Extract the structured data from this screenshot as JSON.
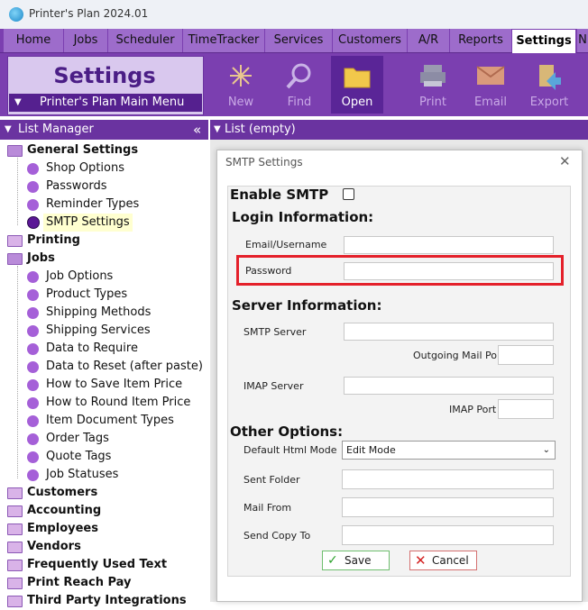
{
  "window": {
    "title": "Printer's Plan 2024.01"
  },
  "menu": {
    "tabs": [
      "Home",
      "Jobs",
      "Scheduler",
      "TimeTracker",
      "Services",
      "Customers",
      "A/R",
      "Reports",
      "Settings",
      "N"
    ],
    "active": "Settings"
  },
  "ribbon": {
    "title": "Settings",
    "main_menu": "Printer's Plan Main Menu",
    "buttons": {
      "new": "New",
      "find": "Find",
      "open": "Open",
      "print": "Print",
      "email": "Email",
      "export": "Export"
    }
  },
  "list_manager": {
    "header": "List Manager",
    "collapse_icon": "«",
    "tree": {
      "general_settings": "General Settings",
      "shop_options": "Shop Options",
      "passwords": "Passwords",
      "reminder_types": "Reminder Types",
      "smtp_settings": "SMTP Settings",
      "printing": "Printing",
      "jobs": "Jobs",
      "job_options": "Job Options",
      "product_types": "Product Types",
      "shipping_methods": "Shipping Methods",
      "shipping_services": "Shipping Services",
      "data_to_require": "Data to Require",
      "data_to_reset": "Data to Reset (after paste)",
      "how_to_save": "How to Save Item Price",
      "how_to_round": "How to Round Item Price",
      "item_document_types": "Item Document Types",
      "order_tags": "Order Tags",
      "quote_tags": "Quote Tags",
      "job_statuses": "Job Statuses",
      "customers": "Customers",
      "accounting": "Accounting",
      "employees": "Employees",
      "vendors": "Vendors",
      "frequently_used_text": "Frequently Used Text",
      "print_reach_pay": "Print Reach Pay",
      "third_party": "Third Party Integrations"
    }
  },
  "list_panel": {
    "header": "List (empty)"
  },
  "dialog": {
    "title": "SMTP Settings",
    "enable_smtp": "Enable SMTP",
    "enable_checked": false,
    "login_section": "Login Information:",
    "email_label": "Email/Username",
    "email_value": "",
    "password_label": "Password",
    "password_value": "",
    "server_section": "Server Information:",
    "smtp_server_label": "SMTP Server",
    "outgoing_port_label": "Outgoing Mail Port",
    "imap_server_label": "IMAP Server",
    "imap_port_label": "IMAP Port",
    "other_section": "Other Options:",
    "html_mode_label": "Default Html Mode",
    "html_mode_value": "Edit Mode",
    "sent_folder_label": "Sent Folder",
    "mail_from_label": "Mail From",
    "send_copy_label": "Send Copy To",
    "save": "Save",
    "cancel": "Cancel"
  },
  "colors": {
    "purple": "#7b3fb0",
    "dark_purple": "#55208f",
    "highlight": "#e4202a"
  }
}
